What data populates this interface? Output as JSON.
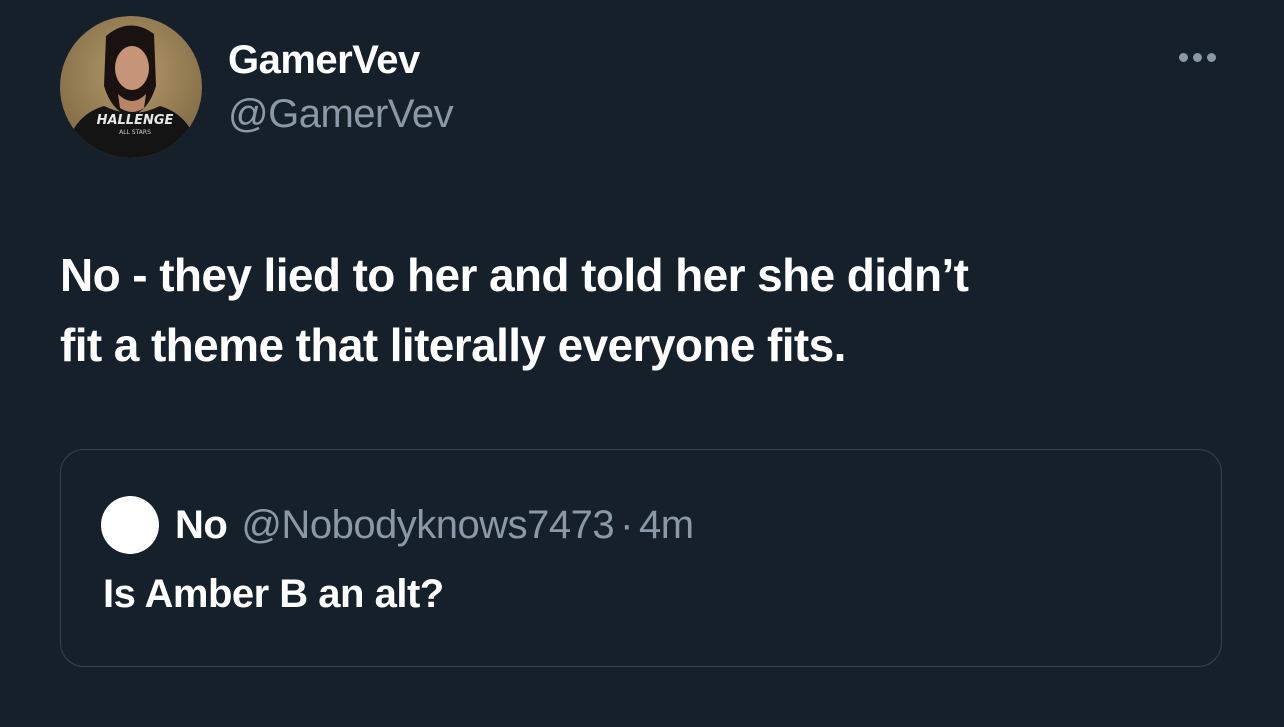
{
  "tweet": {
    "author": {
      "display_name": "GamerVev",
      "handle": "@GamerVev",
      "avatar_shirt_text": "HALLENGE",
      "avatar_shirt_subtext": "ALL STARS"
    },
    "more_icon": "more-dots-icon",
    "text_line1": "No - they lied to her and told her she didn’t",
    "text_line2": "fit a theme that literally everyone fits.",
    "quoted": {
      "display_name": "No",
      "handle": "@Nobodyknows7473",
      "separator": "·",
      "time": "4m",
      "text": "Is Amber B an alt?"
    }
  },
  "colors": {
    "background": "#15202b",
    "primary_text": "#ffffff",
    "secondary_text": "#8b98a5",
    "border": "#38444d"
  }
}
